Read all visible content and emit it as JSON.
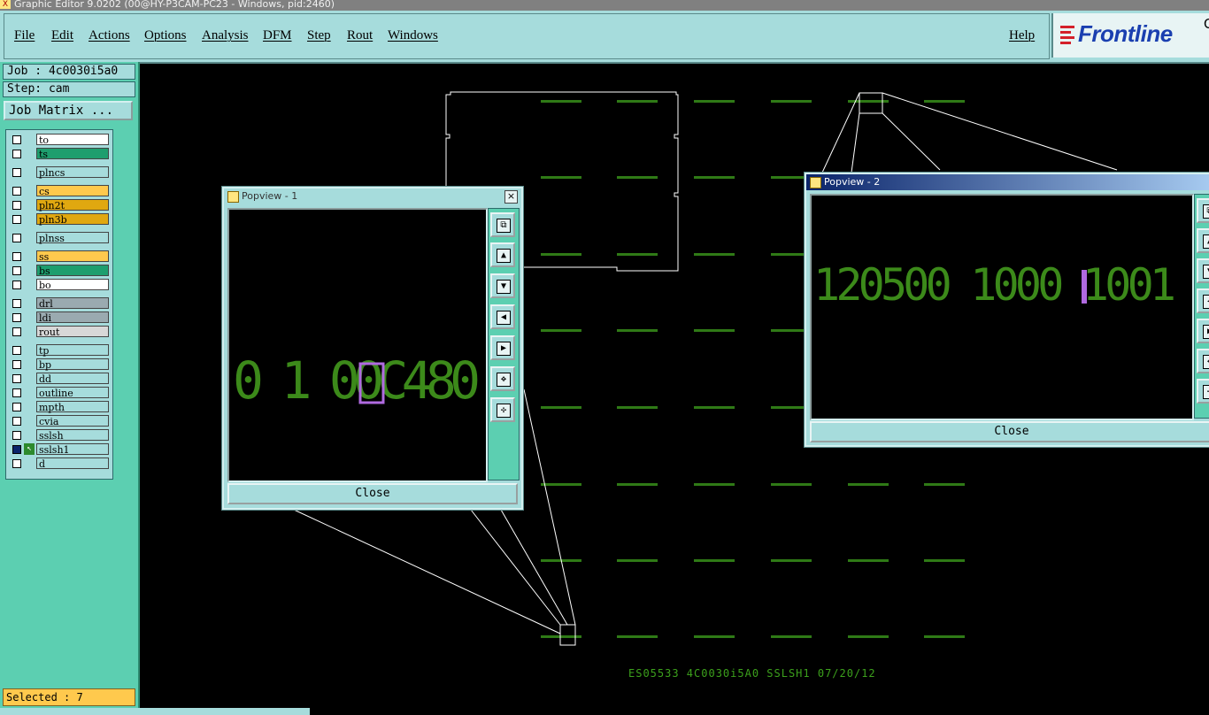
{
  "window": {
    "title": "Graphic Editor 9.0202 (00@HY-P3CAM-PC23 - Windows, pid:2460)"
  },
  "menu": {
    "items": [
      "File",
      "Edit",
      "Actions",
      "Options",
      "Analysis",
      "DFM",
      "Step",
      "Rout",
      "Windows"
    ],
    "help": "Help"
  },
  "logo": {
    "text": "Frontline",
    "suffix": "C"
  },
  "sidebar": {
    "job": "Job : 4c0030i5a0",
    "step": "Step: cam",
    "job_matrix": "Job Matrix ...",
    "selected": "Selected : 7",
    "layers": [
      {
        "name": "to",
        "color": "#ffffff"
      },
      {
        "name": "ts",
        "color": "#1e9e6e"
      },
      {
        "name": "plncs",
        "color": "#a6dcdc"
      },
      {
        "name": "cs",
        "color": "#ffc94d"
      },
      {
        "name": "pln2t",
        "color": "#e0a810"
      },
      {
        "name": "pln3b",
        "color": "#e0a810"
      },
      {
        "name": "plnss",
        "color": "#a6dcdc"
      },
      {
        "name": "ss",
        "color": "#ffc94d"
      },
      {
        "name": "bs",
        "color": "#1e9e6e"
      },
      {
        "name": "bo",
        "color": "#ffffff"
      },
      {
        "name": "drl",
        "color": "#9aaab0"
      },
      {
        "name": "ldi",
        "color": "#9aaab0"
      },
      {
        "name": "rout",
        "color": "#d8d8d8"
      },
      {
        "name": "tp",
        "color": "#a6dcdc"
      },
      {
        "name": "bp",
        "color": "#a6dcdc"
      },
      {
        "name": "dd",
        "color": "#a6dcdc"
      },
      {
        "name": "outline",
        "color": "#a6dcdc"
      },
      {
        "name": "mpth",
        "color": "#a6dcdc"
      },
      {
        "name": "cvia",
        "color": "#a6dcdc"
      },
      {
        "name": "sslsh",
        "color": "#a6dcdc"
      },
      {
        "name": "sslsh1",
        "color": "#a6dcdc"
      },
      {
        "name": "d",
        "color": "#a6dcdc"
      }
    ]
  },
  "popview1": {
    "title": "Popview - 1",
    "close": "Close",
    "digits": "0 1 00C480",
    "close_x": "×"
  },
  "popview2": {
    "title": "Popview - 2",
    "close": "Close",
    "digits": "120500 1000 1001"
  },
  "canvas": {
    "footer": "ES05533 4C0030i5A0 SSLSH1 07/20/12"
  },
  "colors": {
    "accent_teal": "#a6dcdc",
    "sidebar_green": "#5ccfb1",
    "trace_green": "#3ca01c",
    "highlight_purple": "#b06ae0"
  }
}
